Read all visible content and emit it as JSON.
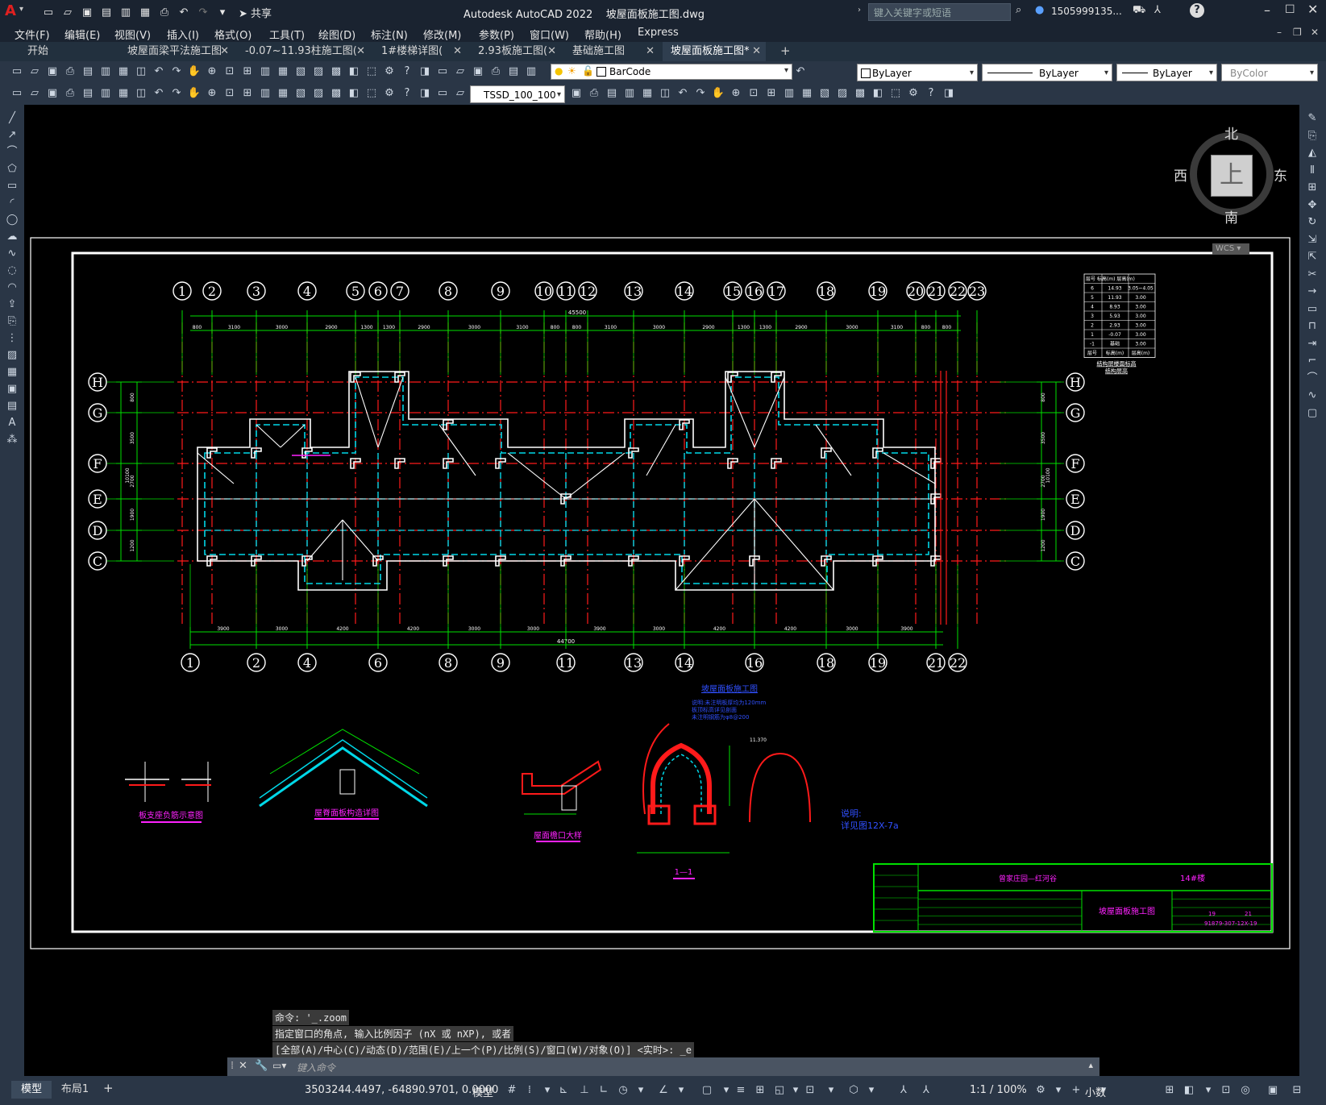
{
  "app": {
    "logo": "A",
    "title": "Autodesk AutoCAD 2022",
    "filename": "坡屋面板施工图.dwg",
    "share": "共享",
    "search_placeholder": "键入关键字或短语",
    "user": "1505999135...",
    "help": "?"
  },
  "menu": [
    "文件(F)",
    "编辑(E)",
    "视图(V)",
    "插入(I)",
    "格式(O)",
    "工具(T)",
    "绘图(D)",
    "标注(N)",
    "修改(M)",
    "参数(P)",
    "窗口(W)",
    "帮助(H)",
    "Express"
  ],
  "tabs": [
    "开始",
    "坡屋面梁平法施工图",
    "-0.07~11.93柱施工图(",
    "1#楼梯详图(",
    "2.93板施工图(",
    "基础施工图",
    "坡屋面板施工图*"
  ],
  "toolbar": {
    "layer": "BarCode",
    "color": "ByLayer",
    "linetype": "ByLayer",
    "lineweight": "ByLayer",
    "plotstyle": "ByColor",
    "dimstyle": "TSSD_100_100"
  },
  "viewcube": {
    "north": "北",
    "south": "南",
    "east": "东",
    "west": "西",
    "top": "上",
    "wcs": "WCS"
  },
  "drawing": {
    "top_axes": [
      "1",
      "2",
      "3",
      "4",
      "5",
      "6",
      "7",
      "8",
      "9",
      "10",
      "11",
      "12",
      "13",
      "14",
      "15",
      "16",
      "17",
      "18",
      "19",
      "20",
      "21",
      "22",
      "23"
    ],
    "bottom_axes": [
      "1",
      "2",
      "4",
      "6",
      "8",
      "9",
      "11",
      "13",
      "14",
      "16",
      "18",
      "19",
      "21",
      "22"
    ],
    "row_axes": [
      "H",
      "G",
      "F",
      "E",
      "D",
      "C"
    ],
    "top_dims": [
      "800",
      "3100",
      "3000",
      "2900",
      "1300",
      "1300",
      "2900",
      "3000",
      "3100",
      "800",
      "800",
      "3100",
      "3000",
      "2900",
      "1300",
      "1300",
      "2900",
      "3000",
      "3100",
      "800",
      "800"
    ],
    "top_total": "45500",
    "bottom_dims": [
      "3900",
      "3000",
      "4200",
      "4200",
      "3000",
      "3000",
      "3900",
      "3000",
      "4200",
      "4200",
      "3000",
      "3900"
    ],
    "bottom_total": "44700",
    "left_dims": [
      "800",
      "3500",
      "2700",
      "1900",
      "1200"
    ],
    "left_total": "10100",
    "detail_titles": [
      "板支座负筋示意图",
      "屋脊面板构造详图",
      "屋面檐口大样",
      "1—1"
    ],
    "red_note": "说明:\n详见图12X-7a",
    "blue_title": "坡屋面板施工图",
    "blue_notes": "说明:未注明板厚均为120mm\n板顶标高详见剖面\n未注明钢筋为φ8@200",
    "elevation_label": "11.370",
    "level_table": {
      "header": [
        "层号",
        "标高(m)",
        "层高(m)"
      ],
      "rows": [
        [
          "6",
          "14.93",
          "3.05~4.05"
        ],
        [
          "5",
          "11.93",
          "3.00"
        ],
        [
          "4",
          "8.93",
          "3.00"
        ],
        [
          "3",
          "5.93",
          "3.00"
        ],
        [
          "2",
          "2.93",
          "3.00"
        ],
        [
          "1",
          "-0.07",
          "3.00"
        ],
        [
          "-1",
          "基础",
          "3.00"
        ],
        [
          "层号",
          "标高(m)",
          "层高(m)"
        ]
      ],
      "caption": "结构层楼面标高\n结构层高"
    },
    "title_block": {
      "project": "曾家庄园—红河谷",
      "building": "14#楼",
      "drawing_name": "坡屋面板施工图",
      "drawing_no": "91879-307-12X-19",
      "sheet": "19",
      "total": "21"
    }
  },
  "command": {
    "history": [
      "命令: '_.zoom",
      "指定窗口的角点, 输入比例因子 (nX 或 nXP), 或者",
      "[全部(A)/中心(C)/动态(D)/范围(E)/上一个(P)/比例(S)/窗口(W)/对象(O)] <实时>: _e"
    ],
    "placeholder": "键入命令"
  },
  "status": {
    "tab_model": "模型",
    "tab_layout": "布局1",
    "coords": "3503244.4497, -64890.9701, 0.0000",
    "mode": "模型",
    "scale": "1:1 / 100%",
    "units": "小数"
  },
  "colors": {
    "green": "#00e000",
    "red": "#ff1a1a",
    "cyan": "#00d8e8",
    "white": "#ffffff",
    "magenta": "#ff22ff",
    "blue": "#3050ff"
  }
}
